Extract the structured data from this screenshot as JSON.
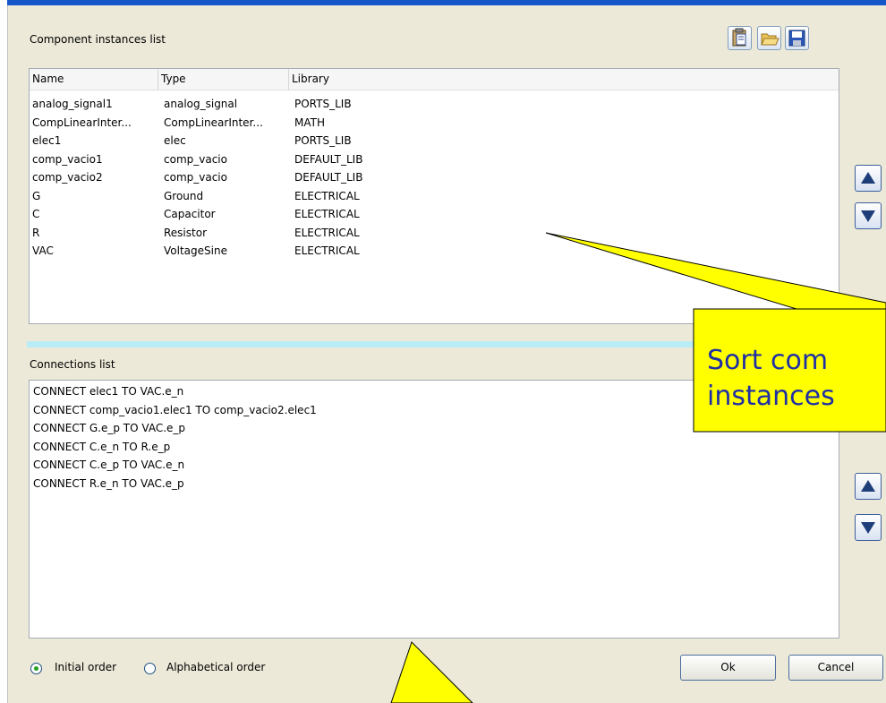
{
  "instances": {
    "label": "Component instances list",
    "columns": [
      "Name",
      "Type",
      "Library"
    ],
    "rows": [
      [
        "analog_signal1",
        "analog_signal",
        "PORTS_LIB"
      ],
      [
        "CompLinearInter...",
        "CompLinearInter...",
        "MATH"
      ],
      [
        "elec1",
        "elec",
        "PORTS_LIB"
      ],
      [
        "comp_vacio1",
        "comp_vacio",
        "DEFAULT_LIB"
      ],
      [
        "comp_vacio2",
        "comp_vacio",
        "DEFAULT_LIB"
      ],
      [
        "G",
        "Ground",
        "ELECTRICAL"
      ],
      [
        "C",
        "Capacitor",
        "ELECTRICAL"
      ],
      [
        "R",
        "Resistor",
        "ELECTRICAL"
      ],
      [
        "VAC",
        "VoltageSine",
        "ELECTRICAL"
      ]
    ]
  },
  "toolbar": {
    "icons": [
      "paste-icon",
      "folder-open-icon",
      "save-icon"
    ]
  },
  "connections": {
    "label": "Connections list",
    "rows": [
      "CONNECT elec1 TO VAC.e_n",
      "CONNECT comp_vacio1.elec1 TO comp_vacio2.elec1",
      "CONNECT G.e_p TO VAC.e_p",
      "CONNECT C.e_n TO R.e_p",
      "CONNECT C.e_p TO VAC.e_n",
      "CONNECT R.e_n TO VAC.e_p"
    ]
  },
  "order": {
    "initial_label": "Initial order",
    "alphabetical_label": "Alphabetical order",
    "selected": "initial"
  },
  "buttons": {
    "ok": "Ok",
    "cancel": "Cancel"
  },
  "callout": {
    "line1": "Sort com",
    "line2": "instances"
  },
  "colors": {
    "callout_fill": "#ffff00",
    "callout_text": "#1f2fa5",
    "splitter": "#b8ecf6",
    "title_strip": "#1455c8"
  }
}
